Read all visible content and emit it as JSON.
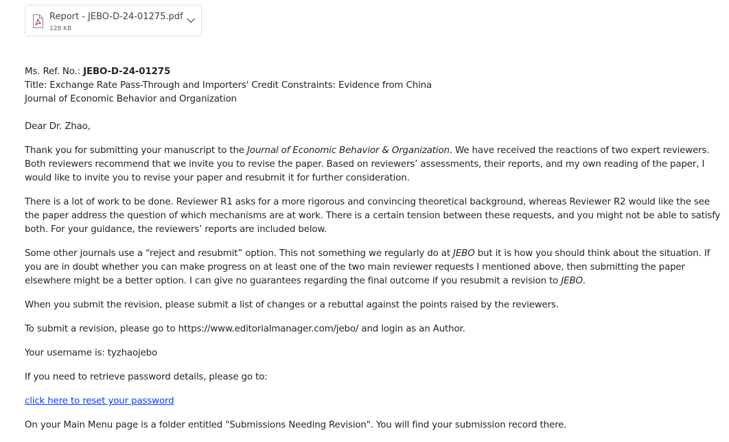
{
  "attachment": {
    "file_name": "Report - JEBO-D-24-01275.pdf",
    "file_size": "128 KB",
    "icon": "pdf-file-icon",
    "menu_icon": "chevron-down-icon"
  },
  "email": {
    "ms_ref_label": "Ms. Ref. No.: ",
    "ms_ref_value": "JEBO-D-24-01275",
    "title_line": "Title: Exchange Rate Pass-Through and Importers' Credit Constraints: Evidence from China",
    "journal_line": "Journal of Economic Behavior and Organization",
    "greeting": "Dear Dr. Zhao,",
    "para1_a": "Thank you for submitting your manuscript to the ",
    "para1_journal": "Journal of Economic Behavior & Organization",
    "para1_b": ". We have received the reactions of two expert reviewers. Both reviewers recommend that we invite you to revise the paper. Based on reviewers’ assessments, their reports, and my own reading of the paper, I would like to invite you to revise your paper and resubmit it for further consideration.",
    "para2": "There is a lot of work to be done. Reviewer R1 asks for a more rigorous and convincing theoretical background, whereas Reviewer R2 would like the see the paper address the question of which mechanisms are at work. There is a certain tension between these requests, and you might not be able to satisfy both. For your guidance, the reviewers’ reports are included below.",
    "para3_a": "Some other journals use a “reject and resubmit” option. This not something we regularly do at ",
    "para3_jebo1": "JEBO",
    "para3_b": " but it is how you should think about the situation. If you are in doubt whether you can make progress on at least one of the two main reviewer requests I mentioned above, then submitting the paper elsewhere might be a better option. I can give no guarantees regarding the final outcome if you resubmit a revision to ",
    "para3_jebo2": "JEBO",
    "para3_c": ".",
    "para4": "When you submit the revision, please submit a list of changes or a rebuttal against the points raised by the reviewers.",
    "para5": "To submit a revision, please go to https://www.editorialmanager.com/jebo/ and login as an Author.",
    "para6": "Your username is: tyzhaojebo",
    "para7": "If you need to retrieve password details, please go to:",
    "reset_link": "click here to reset your password",
    "para8": "On your Main Menu page is a folder entitled \"Submissions Needing Revision\". You will find your submission record there."
  },
  "colors": {
    "text": "#242424",
    "link": "#0b3cff",
    "pdf_red": "#c4314b",
    "border": "#e1e1e1"
  }
}
